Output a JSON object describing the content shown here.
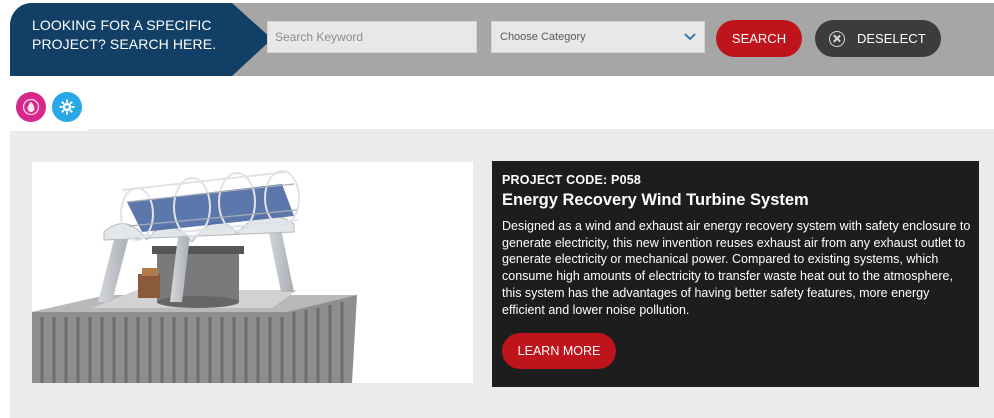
{
  "search": {
    "banner_text": "LOOKING FOR A SPECIFIC PROJECT? SEARCH HERE.",
    "keyword_placeholder": "Search Keyword",
    "keyword_value": "",
    "category_selected": "Choose Category",
    "search_label": "SEARCH",
    "deselect_label": "DESELECT"
  },
  "categories": [
    {
      "icon": "water-drop-icon",
      "color": "#d6288a"
    },
    {
      "icon": "energy-gear-icon",
      "color": "#29a8e6"
    }
  ],
  "project": {
    "code": "PROJECT CODE: P058",
    "title": "Energy Recovery Wind Turbine System",
    "description": "Designed as a wind and exhaust air energy recovery system with safety enclosure to generate electricity, this new invention reuses exhaust air from any exhaust outlet to generate electricity or mechanical power. Compared to existing systems, which consume high amounts of electricity to transfer waste heat out to the atmosphere, this system has the advantages of having better safety features, more energy efficient and lower noise pollution.",
    "learn_more_label": "LEARN MORE",
    "image_alt": "wind-turbine-render"
  },
  "colors": {
    "navy": "#123f66",
    "accent_red": "#c0141d",
    "dark_panel": "#1d1d1d",
    "searchbar_gray": "#a6a6a6"
  }
}
